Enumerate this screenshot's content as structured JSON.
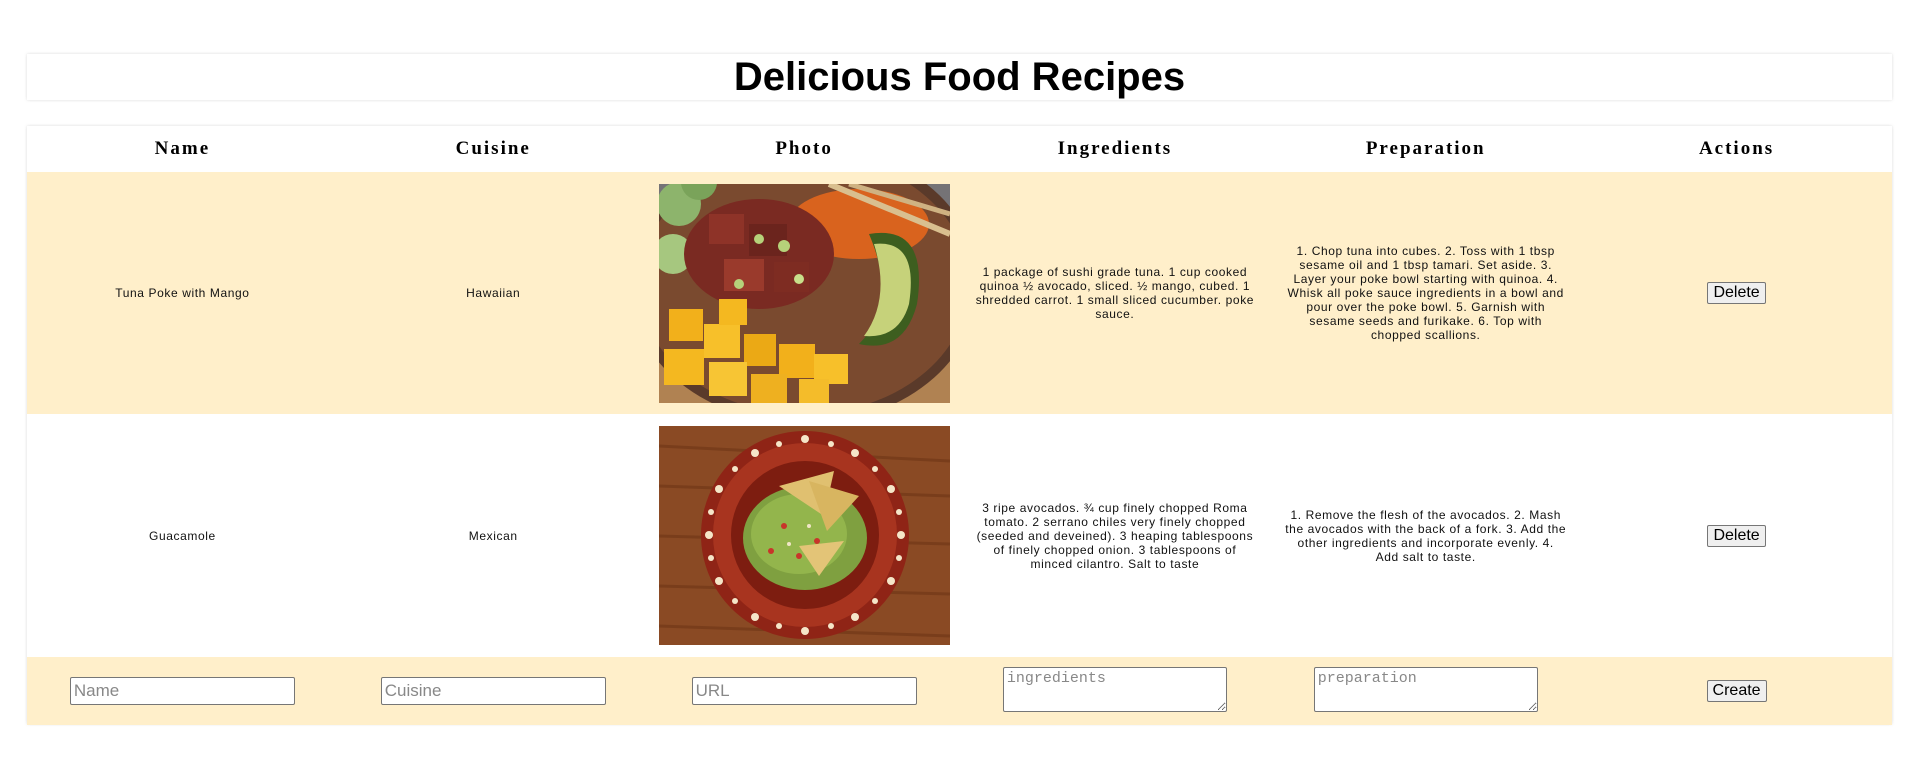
{
  "page": {
    "title": "Delicious Food Recipes"
  },
  "table": {
    "headers": [
      "Name",
      "Cuisine",
      "Photo",
      "Ingredients",
      "Preparation",
      "Actions"
    ],
    "rows": [
      {
        "name": "Tuna Poke with Mango",
        "cuisine": "Hawaiian",
        "photo_alt": "Tuna poke bowl with mango and avocado",
        "ingredients": "1 package of sushi grade tuna. 1 cup cooked quinoa ½ avocado, sliced. ½ mango, cubed. 1 shredded carrot. 1 small sliced cucumber. poke sauce.",
        "preparation": "1. Chop tuna into cubes. 2. Toss with 1 tbsp sesame oil and 1 tbsp tamari. Set aside. 3. Layer your poke bowl starting with quinoa. 4. Whisk all poke sauce ingredients in a bowl and pour over the poke bowl. 5. Garnish with sesame seeds and furikake. 6. Top with chopped scallions.",
        "action_label": "Delete"
      },
      {
        "name": "Guacamole",
        "cuisine": "Mexican",
        "photo_alt": "Guacamole with tortilla chips on a decorated plate",
        "ingredients": "3 ripe avocados. ¾ cup finely chopped Roma tomato. 2 serrano chiles very finely chopped (seeded and deveined). 3 heaping tablespoons of finely chopped onion. 3 tablespoons of minced cilantro. Salt to taste",
        "preparation": "1. Remove the flesh of the avocados. 2. Mash the avocados with the back of a fork. 3. Add the other ingredients and incorporate evenly. 4. Add salt to taste.",
        "action_label": "Delete"
      }
    ],
    "form": {
      "name_placeholder": "Name",
      "cuisine_placeholder": "Cuisine",
      "url_placeholder": "URL",
      "ingredients_placeholder": "ingredients",
      "preparation_placeholder": "preparation",
      "create_label": "Create"
    }
  },
  "colors": {
    "row_highlight": "#ffefca",
    "row_plain": "#ffffff"
  }
}
